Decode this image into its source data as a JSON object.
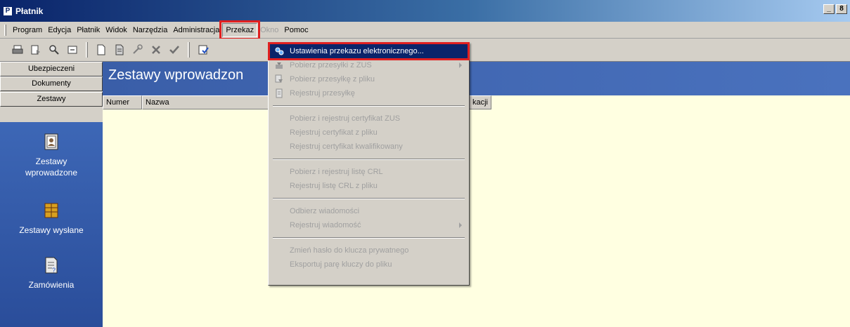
{
  "window": {
    "title": "Płatnik",
    "icon": "P"
  },
  "window_controls": {
    "minimize": "_",
    "restore": "8"
  },
  "menu": [
    {
      "label": "Program",
      "state": "normal"
    },
    {
      "label": "Edycja",
      "state": "normal"
    },
    {
      "label": "Płatnik",
      "state": "normal"
    },
    {
      "label": "Widok",
      "state": "normal"
    },
    {
      "label": "Narzędzia",
      "state": "normal"
    },
    {
      "label": "Administracja",
      "state": "normal"
    },
    {
      "label": "Przekaz",
      "state": "open"
    },
    {
      "label": "Okno",
      "state": "disabled"
    },
    {
      "label": "Pomoc",
      "state": "normal"
    }
  ],
  "toolbar_icons": [
    "print-icon",
    "preview-icon",
    "find-icon",
    "export-icon",
    "new-document-icon",
    "open-document-icon",
    "tools-icon",
    "delete-icon",
    "confirm-icon",
    "check-icon"
  ],
  "nav_tabs": [
    "Ubezpieczeni",
    "Dokumenty",
    "Zestawy"
  ],
  "nav_items": [
    {
      "label": "Zestawy\nwprowadzone",
      "icon": "document-sets-icon"
    },
    {
      "label": "Zestawy wysłane",
      "icon": "sent-sets-icon"
    },
    {
      "label": "Zamówienia",
      "icon": "orders-icon"
    }
  ],
  "main": {
    "title": "Zestawy wprowadzon",
    "columns": [
      "Numer",
      "Nazwa",
      "kacji"
    ]
  },
  "dropdown": {
    "items": [
      {
        "label": "Ustawienia przekazu elektronicznego...",
        "type": "item",
        "active": true,
        "icon": "settings-gear-icon"
      },
      {
        "label": "Pobierz przesyłki z ZUS",
        "type": "item",
        "submenu": true,
        "icon": "download-icon"
      },
      {
        "label": "Pobierz przesyłkę z pliku",
        "type": "item",
        "icon": "file-download-icon"
      },
      {
        "label": "Rejestruj przesyłkę",
        "type": "item",
        "icon": "register-icon"
      },
      {
        "type": "separator"
      },
      {
        "label": "Pobierz i rejestruj certyfikat ZUS",
        "type": "item"
      },
      {
        "label": "Rejestruj certyfikat z pliku",
        "type": "item"
      },
      {
        "label": "Rejestruj certyfikat kwalifikowany",
        "type": "item"
      },
      {
        "type": "separator"
      },
      {
        "label": "Pobierz i rejestruj listę CRL",
        "type": "item"
      },
      {
        "label": "Rejestruj listę CRL z pliku",
        "type": "item"
      },
      {
        "type": "separator"
      },
      {
        "label": "Odbierz wiadomości",
        "type": "item"
      },
      {
        "label": "Rejestruj wiadomość",
        "type": "item",
        "submenu": true
      },
      {
        "type": "separator"
      },
      {
        "label": "Zmień hasło do klucza prywatnego",
        "type": "item"
      },
      {
        "label": "Eksportuj parę kluczy do pliku",
        "type": "item"
      }
    ]
  },
  "colors": {
    "highlight": "#e02020",
    "selection": "#0a246a",
    "nav_blue": "#3d67b6"
  }
}
